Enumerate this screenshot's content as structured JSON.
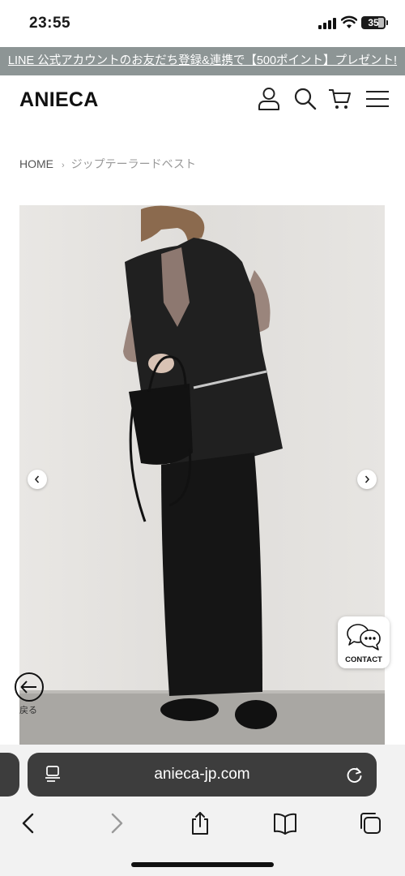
{
  "status_bar": {
    "time": "23:55",
    "battery": "35"
  },
  "promo": {
    "text": "LINE 公式アカウントのお友だち登録&連携で【500ポイント】プレゼント!"
  },
  "header": {
    "logo": "ANIECA",
    "icons": [
      "account-icon",
      "search-icon",
      "cart-icon",
      "menu-icon"
    ]
  },
  "breadcrumb": {
    "home": "HOME",
    "separator": "›",
    "current": "ジップテーラードベスト"
  },
  "carousel": {
    "prev_icon": "chevron-left-icon",
    "next_icon": "chevron-right-icon"
  },
  "contact": {
    "label": "CONTACT"
  },
  "back": {
    "label": "戻る"
  },
  "browser": {
    "url": "anieca-jp.com",
    "toolbar_icons": [
      "back-icon",
      "forward-icon",
      "share-icon",
      "bookmarks-icon",
      "tabs-icon"
    ]
  },
  "colors": {
    "promo_bg": "#8d9595",
    "address_bar_bg": "#3d3d3d",
    "toolbar_bg": "#f2f2f2"
  }
}
